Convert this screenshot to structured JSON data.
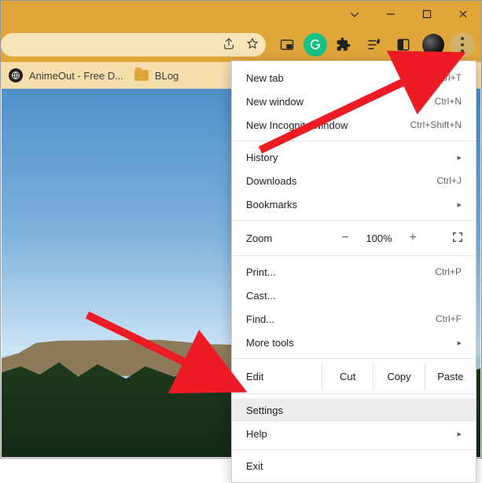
{
  "bookmarks": [
    {
      "label": "AnimeOut - Free D...",
      "icon": "globe"
    },
    {
      "label": "BLog",
      "icon": "folder"
    }
  ],
  "toolbar_icons": [
    "share-icon",
    "star-icon",
    "picture-in-picture-icon",
    "grammarly-icon",
    "extensions-icon",
    "music-queue-icon",
    "reading-list-icon",
    "avatar",
    "kebab-menu"
  ],
  "menu": {
    "new_tab": {
      "label": "New tab",
      "shortcut": "Ctrl+T"
    },
    "new_window": {
      "label": "New window",
      "shortcut": "Ctrl+N"
    },
    "incognito": {
      "label": "New Incognito window",
      "shortcut": "Ctrl+Shift+N"
    },
    "history": {
      "label": "History"
    },
    "downloads": {
      "label": "Downloads",
      "shortcut": "Ctrl+J"
    },
    "bookmarks": {
      "label": "Bookmarks"
    },
    "zoom": {
      "label": "Zoom",
      "value": "100%",
      "minus": "−",
      "plus": "+"
    },
    "print": {
      "label": "Print...",
      "shortcut": "Ctrl+P"
    },
    "cast": {
      "label": "Cast..."
    },
    "find": {
      "label": "Find...",
      "shortcut": "Ctrl+F"
    },
    "more_tools": {
      "label": "More tools"
    },
    "edit": {
      "label": "Edit",
      "cut": "Cut",
      "copy": "Copy",
      "paste": "Paste"
    },
    "settings": {
      "label": "Settings"
    },
    "help": {
      "label": "Help"
    },
    "exit": {
      "label": "Exit"
    }
  }
}
